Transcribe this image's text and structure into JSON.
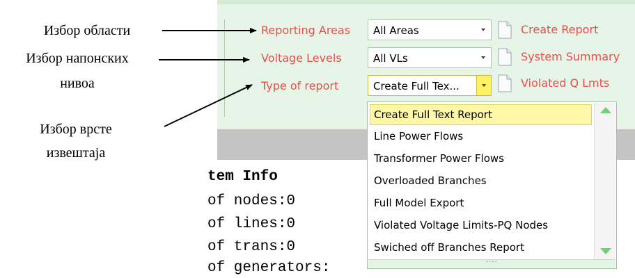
{
  "annotations": {
    "area": "Избор области",
    "voltage_line1": "Избор напонских",
    "voltage_line2": "нивоа",
    "report_line1": "Избор врсте",
    "report_line2": "извештаја"
  },
  "ribbon": {
    "reporting_areas_label": "Reporting Areas",
    "voltage_levels_label": "Voltage Levels",
    "type_of_report_label": "Type of report",
    "reporting_areas_value": "All Areas",
    "voltage_levels_value": "All VLs",
    "type_of_report_value": "Create Full Tex...",
    "buttons": {
      "create_report": "Create Report",
      "system_summary": "System Summary",
      "violated_q": "Violated Q Lmts"
    }
  },
  "dropdown": {
    "items": [
      "Create Full Text Report",
      "Line Power Flows",
      "Transformer Power Flows",
      "Overloaded Branches",
      "Full Model Export",
      "Violated Voltage Limits-PQ Nodes",
      "Swiched off Branches Report"
    ],
    "selected_index": 0,
    "grip": "····"
  },
  "system_info": {
    "title": "tem Info",
    "lines": [
      "of nodes:0",
      "of lines:0",
      "of trans:0",
      "of generators:"
    ]
  },
  "colors": {
    "label_red": "#e0504a",
    "ribbon_bg": "#e6f5e8",
    "selected_bg": "#fff7a8",
    "scroll_arrow": "#6fcf7b"
  }
}
